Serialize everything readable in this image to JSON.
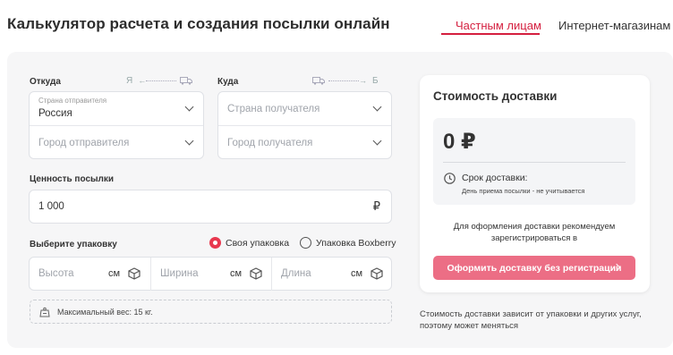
{
  "header": {
    "title": "Калькулятор расчета и создания посылки онлайн",
    "tabs": [
      {
        "label": "Частным лицам",
        "active": true
      },
      {
        "label": "Интернет-магазинам",
        "active": false
      }
    ]
  },
  "from": {
    "label": "Откуда",
    "hint_letter": "Я",
    "country_label": "Страна отправителя",
    "country_value": "Россия",
    "city_placeholder": "Город отправителя"
  },
  "to": {
    "label": "Куда",
    "hint_letter": "Б",
    "country_placeholder": "Страна получателя",
    "city_placeholder": "Город получателя"
  },
  "value": {
    "label": "Ценность посылки",
    "amount": "1 000",
    "currency": "₽"
  },
  "packaging": {
    "label": "Выберите упаковку",
    "options": [
      {
        "label": "Своя упаковка",
        "selected": true
      },
      {
        "label": "Упаковка Boxberry",
        "selected": false
      }
    ],
    "dims": [
      {
        "placeholder": "Высота",
        "unit": "см"
      },
      {
        "placeholder": "Ширина",
        "unit": "см"
      },
      {
        "placeholder": "Длина",
        "unit": "см"
      }
    ],
    "max_weight": "Максимальный вес: 15 кг."
  },
  "cost": {
    "title": "Стоимость доставки",
    "price": "0 ₽",
    "term_label": "Срок доставки:",
    "term_note": "День приема посылки - не учитывается",
    "register_note": "Для оформления доставки рекомендуем зарегистрироваться в",
    "button_label": "Оформить доставку без регистрации",
    "disclaimer": "Стоимость доставки зависит от упаковки и других услуг, поэтому может меняться"
  },
  "colors": {
    "accent": "#d41f3f",
    "button": "#ec6e85",
    "panel": "#f6f6f7"
  }
}
